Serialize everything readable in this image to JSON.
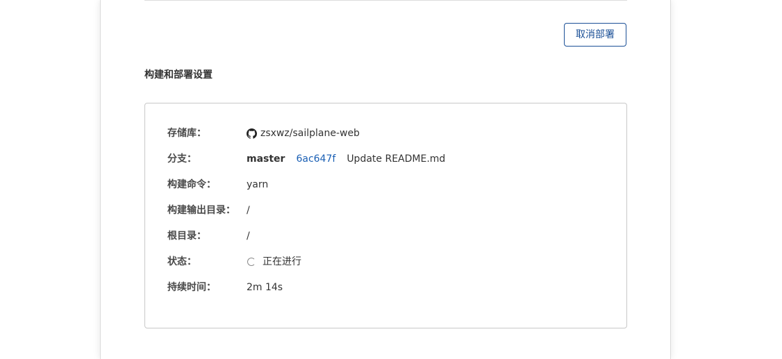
{
  "actions": {
    "cancel_deploy": "取消部署"
  },
  "section": {
    "title": "构建和部署设置"
  },
  "details": {
    "repository": {
      "label": "存储库：",
      "value": "zsxwz/sailplane-web",
      "icon": "github-icon"
    },
    "branch": {
      "label": "分支：",
      "name": "master",
      "commit_hash": "6ac647f",
      "commit_message": "Update README.md"
    },
    "build_command": {
      "label": "构建命令：",
      "value": "yarn"
    },
    "output_dir": {
      "label": "构建输出目录：",
      "value": "/"
    },
    "root_dir": {
      "label": "根目录：",
      "value": "/"
    },
    "status": {
      "label": "状态：",
      "value": "正在进行",
      "icon": "loading-spinner-icon"
    },
    "duration": {
      "label": "持续时间：",
      "value": "2m 14s"
    }
  },
  "colors": {
    "accent": "#1a4f96",
    "link": "#1a5fb4",
    "border": "#c8c8c8"
  }
}
